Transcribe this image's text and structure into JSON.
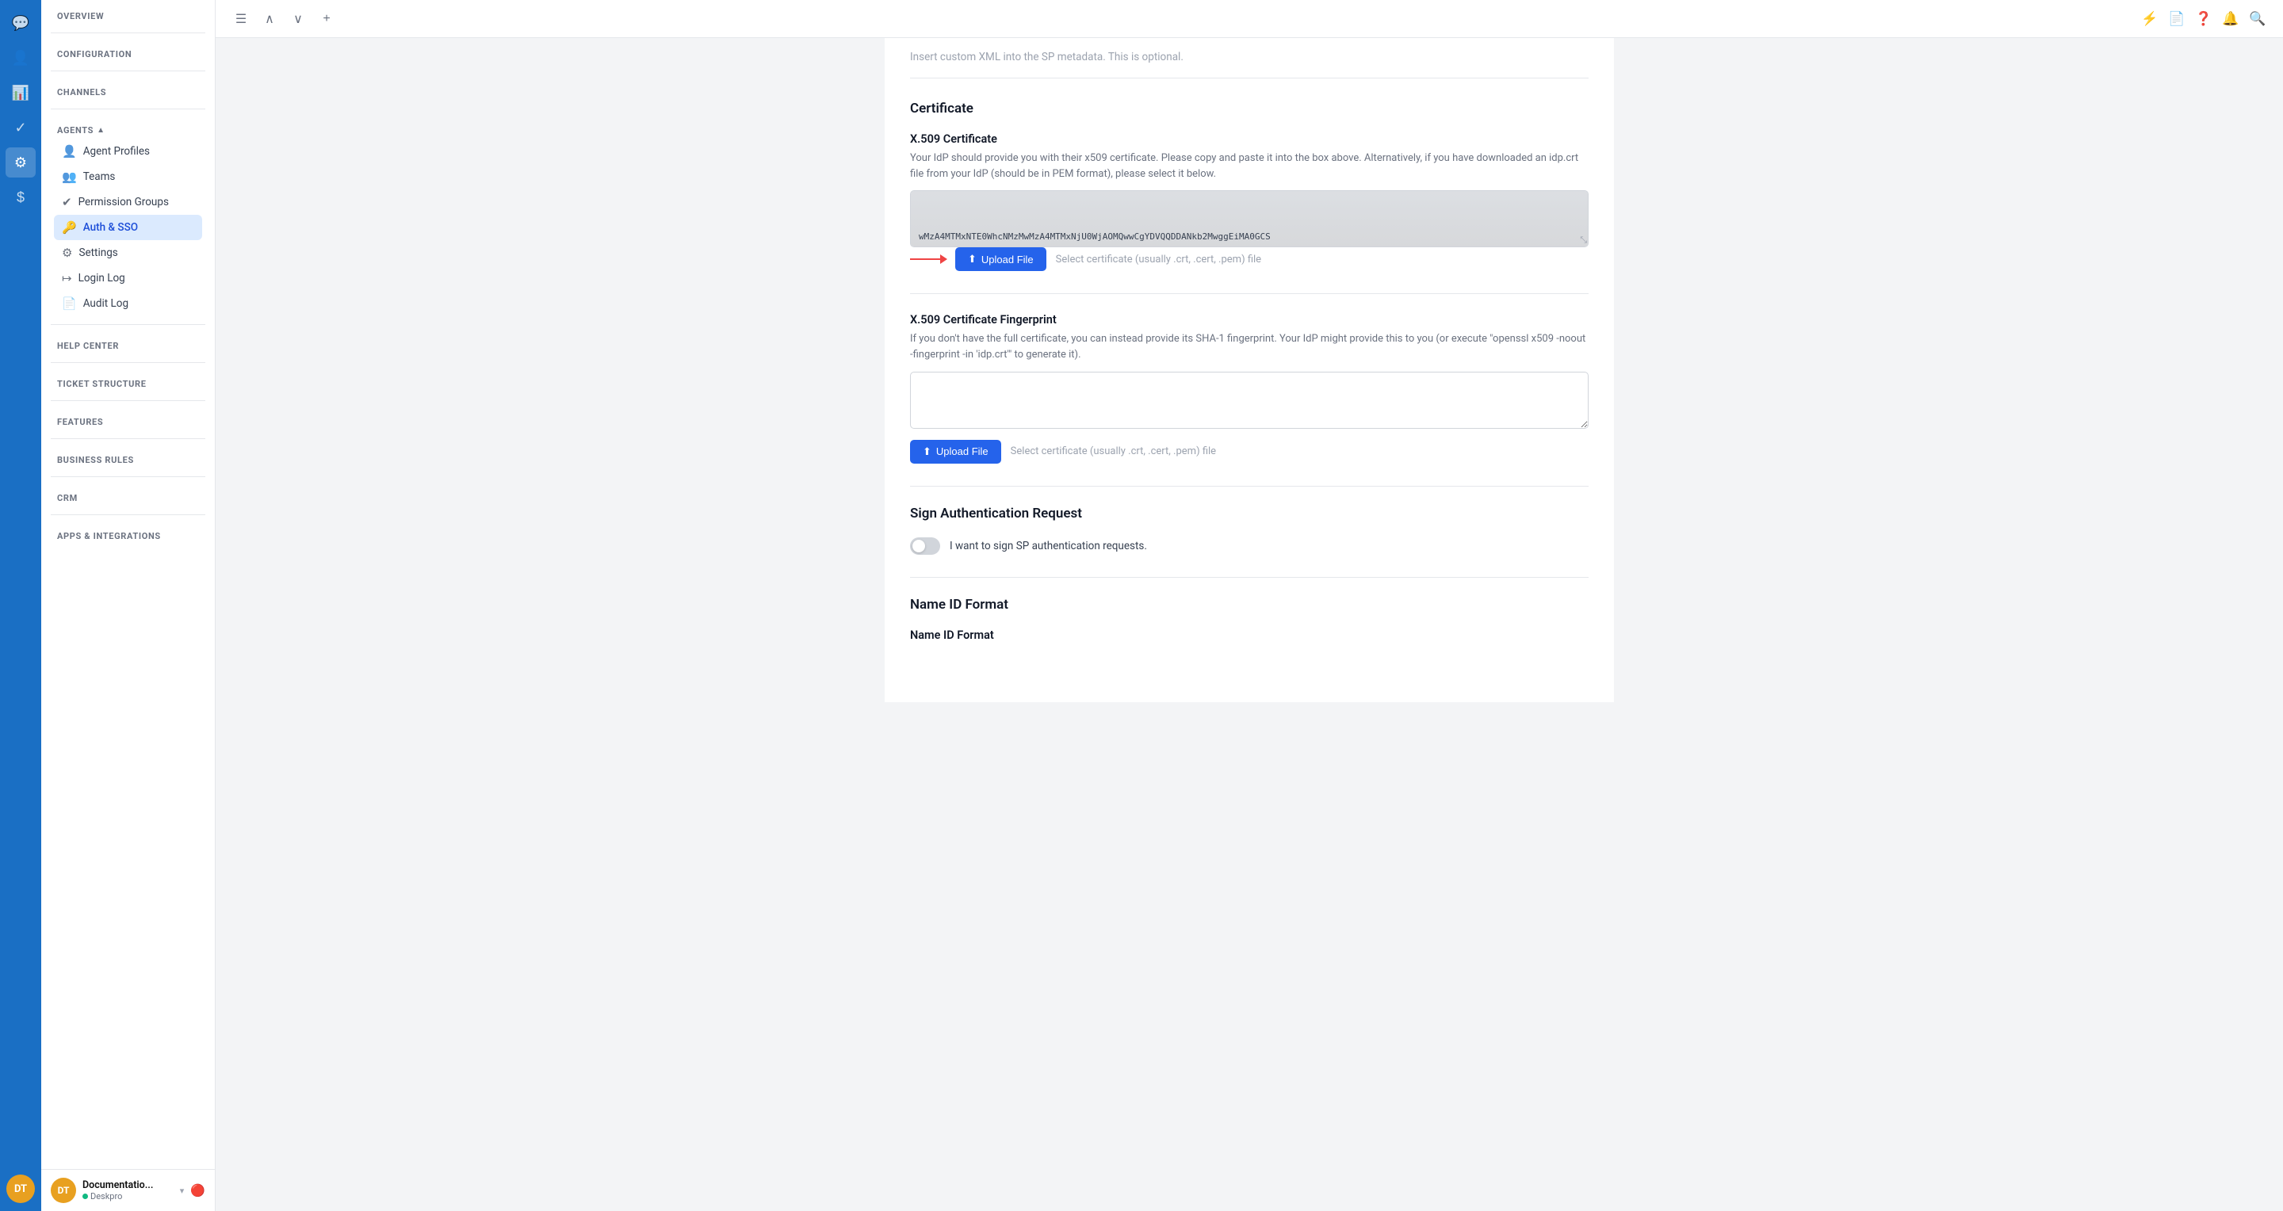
{
  "iconBar": {
    "icons": [
      {
        "name": "chat-icon",
        "symbol": "💬",
        "active": false
      },
      {
        "name": "person-icon",
        "symbol": "👤",
        "active": false
      },
      {
        "name": "chart-icon",
        "symbol": "📊",
        "active": false
      },
      {
        "name": "check-icon",
        "symbol": "✓",
        "active": false
      },
      {
        "name": "settings-icon",
        "symbol": "⚙",
        "active": true
      },
      {
        "name": "dollar-icon",
        "symbol": "$",
        "active": false
      }
    ],
    "avatar": "DT"
  },
  "topToolbar": {
    "icons": [
      "☰",
      "∧",
      "∨",
      "+"
    ]
  },
  "sidebar": {
    "overview": "OVERVIEW",
    "configuration": "CONFIGURATION",
    "channels": "CHANNELS",
    "agents_header": "AGENTS",
    "items": [
      {
        "label": "Agent Profiles",
        "icon": "👤",
        "active": false
      },
      {
        "label": "Teams",
        "icon": "👥",
        "active": false
      },
      {
        "label": "Permission Groups",
        "icon": "✔",
        "active": false
      },
      {
        "label": "Auth & SSO",
        "icon": "🔑",
        "active": true
      },
      {
        "label": "Settings",
        "icon": "⚙",
        "active": false
      },
      {
        "label": "Login Log",
        "icon": "↦",
        "active": false
      },
      {
        "label": "Audit Log",
        "icon": "📄",
        "active": false
      }
    ],
    "help_center": "HELP CENTER",
    "ticket_structure": "TICKET STRUCTURE",
    "features": "FEATURES",
    "business_rules": "BUSINESS RULES",
    "crm": "CRM",
    "apps_integrations": "APPS & INTEGRATIONS",
    "footer": {
      "avatar": "DT",
      "name": "Documentatio...",
      "org": "Deskpro"
    }
  },
  "content": {
    "top_hint": "Insert custom XML into the SP metadata. This is optional.",
    "certificate_section": "Certificate",
    "x509_label": "X.509 Certificate",
    "x509_desc": "Your IdP should provide you with their x509 certificate. Please copy and paste it into the box above. Alternatively, if you have downloaded an idp.crt file from your IdP (should be in PEM format), please select it below.",
    "cert_value": "wMzA4MTMxNTE0WhcNMzMwMzA4MTMxNjU0WjAOMQwwCgYDVQQDDANkb2MwggEiMA0GCS",
    "upload_btn_label": "Upload File",
    "upload_hint": "Select certificate (usually .crt, .cert, .pem) file",
    "x509_fp_label": "X.509 Certificate Fingerprint",
    "x509_fp_desc": "If you don't have the full certificate, you can instead provide its SHA-1 fingerprint. Your IdP might provide this to you (or execute \"openssl x509 -noout -fingerprint -in 'idp.crt'\" to generate it).",
    "upload_btn2_label": "Upload File",
    "upload_hint2": "Select certificate (usually .crt, .cert, .pem) file",
    "sign_auth_label": "Sign Authentication Request",
    "sign_toggle_label": "I want to sign SP authentication requests.",
    "name_id_label": "Name ID Format",
    "name_id_sub": "Name ID Format"
  },
  "headerIcons": {
    "bolt": "⚡",
    "doc": "📄",
    "help": "❓",
    "bell": "🔔",
    "search": "🔍"
  }
}
